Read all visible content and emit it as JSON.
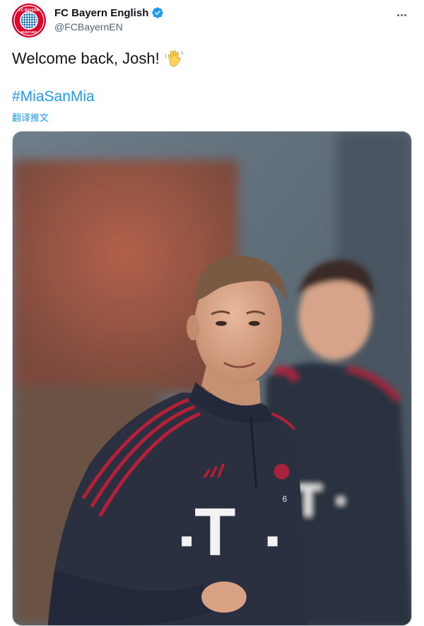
{
  "tweet": {
    "display_name": "FC Bayern English",
    "handle": "@FCBayernEN",
    "text": "Welcome back, Josh!",
    "emoji": "waving-hand",
    "hashtag": "#MiaSanMia",
    "translate_label": "翻译推文",
    "verified": true
  },
  "avatar": {
    "logo_top_text": "FC BAYERN",
    "logo_bottom_text": "MÜNCHEN"
  },
  "icons": {
    "verified_badge": "verified-badge-icon",
    "more": "more-dots-icon",
    "wave": "waving-hand-icon"
  },
  "colors": {
    "accent": "#1d9bf0",
    "bayern_red": "#dc052d",
    "bayern_blue": "#0066b2",
    "jersey": "#2b3040"
  },
  "media": {
    "description": "photo",
    "shirt_sponsor_letter": "T",
    "shirt_number": "6"
  }
}
